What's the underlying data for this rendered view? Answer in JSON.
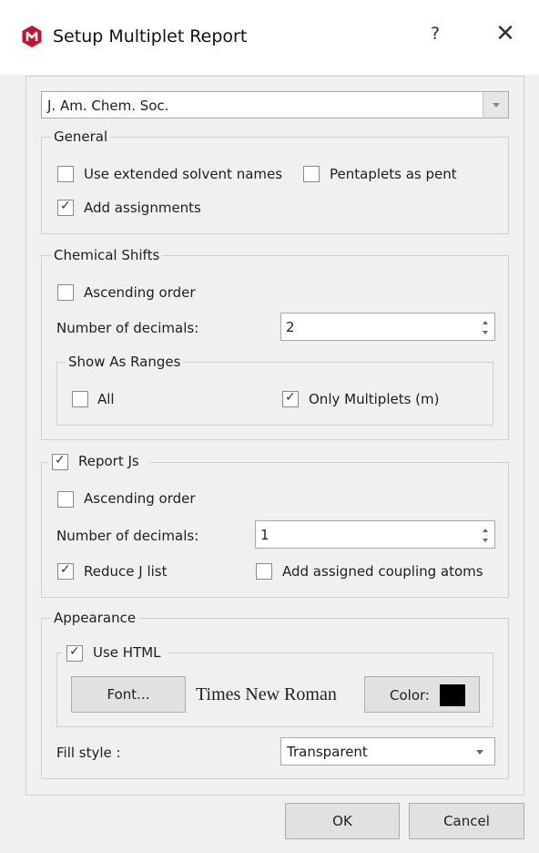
{
  "window": {
    "title": "Setup Multiplet Report",
    "help_label": "?",
    "close_label": "✕"
  },
  "format_combo": {
    "value": "J. Am. Chem. Soc."
  },
  "general": {
    "legend": "General",
    "use_extended_solvent_names": {
      "label": "Use extended solvent names",
      "checked": false
    },
    "pentaplets_as_pent": {
      "label": "Pentaplets as pent",
      "checked": false
    },
    "add_assignments": {
      "label": "Add assignments",
      "checked": true
    }
  },
  "chemical_shifts": {
    "legend": "Chemical Shifts",
    "ascending_order": {
      "label": "Ascending order",
      "checked": false
    },
    "decimals_label": "Number of decimals:",
    "decimals_value": "2",
    "ranges": {
      "legend": "Show As Ranges",
      "all": {
        "label": "All",
        "checked": false
      },
      "only_multiplets": {
        "label": "Only Multiplets (m)",
        "checked": true
      }
    }
  },
  "report_js": {
    "legend": "Report Js",
    "checked": true,
    "ascending_order": {
      "label": "Ascending order",
      "checked": false
    },
    "decimals_label": "Number of decimals:",
    "decimals_value": "1",
    "reduce_j_list": {
      "label": "Reduce J list",
      "checked": true
    },
    "add_assigned_coupling_atoms": {
      "label": "Add assigned coupling atoms",
      "checked": false
    }
  },
  "appearance": {
    "legend": "Appearance",
    "use_html": {
      "label": "Use HTML",
      "checked": true
    },
    "font_button": "Font...",
    "font_name": "Times New Roman",
    "color_button": "Color:",
    "color_value": "#000000",
    "fill_style_label": "Fill style :",
    "fill_style_value": "Transparent"
  },
  "footer": {
    "ok": "OK",
    "cancel": "Cancel"
  },
  "colors": {
    "logo": "#c8102e",
    "dialog_bg": "#f0f0f0",
    "group_border": "#cfcfcf"
  }
}
